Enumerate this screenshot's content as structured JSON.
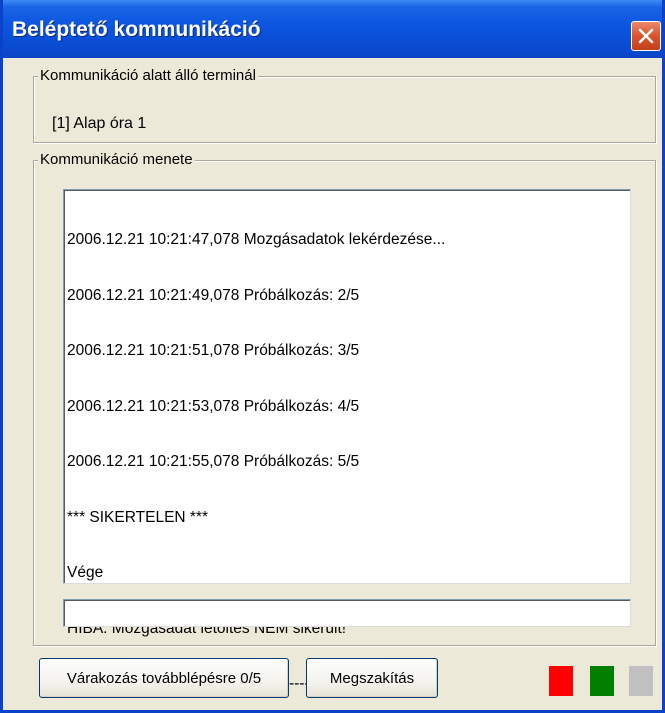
{
  "window": {
    "title": "Beléptető kommunikáció",
    "close_icon": "close-icon"
  },
  "terminal_group": {
    "legend": "Kommunikáció alatt álló terminál",
    "terminal_name": "[1] Alap óra 1"
  },
  "progress_group": {
    "legend": "Kommunikáció menete",
    "log_lines": [
      "2006.12.21 10:21:47,078 Mozgásadatok lekérdezése...",
      "2006.12.21 10:21:49,078 Próbálkozás: 2/5",
      "2006.12.21 10:21:51,078 Próbálkozás: 3/5",
      "2006.12.21 10:21:53,078 Próbálkozás: 4/5",
      "2006.12.21 10:21:55,078 Próbálkozás: 5/5",
      "*** SIKERTELEN ***",
      "Vége",
      "HIBA: Mozgásadat letöltés NEM sikerült!",
      "--------------------------------------------------------------"
    ],
    "status_value": ""
  },
  "buttons": {
    "wait_label": "Várakozás továbblépésre 0/5",
    "abort_label": "Megszakítás"
  },
  "indicators": [
    {
      "name": "red-led",
      "color": "#ff0000"
    },
    {
      "name": "green-led",
      "color": "#008000"
    },
    {
      "name": "gray-led",
      "color": "#c0c0c0"
    }
  ]
}
